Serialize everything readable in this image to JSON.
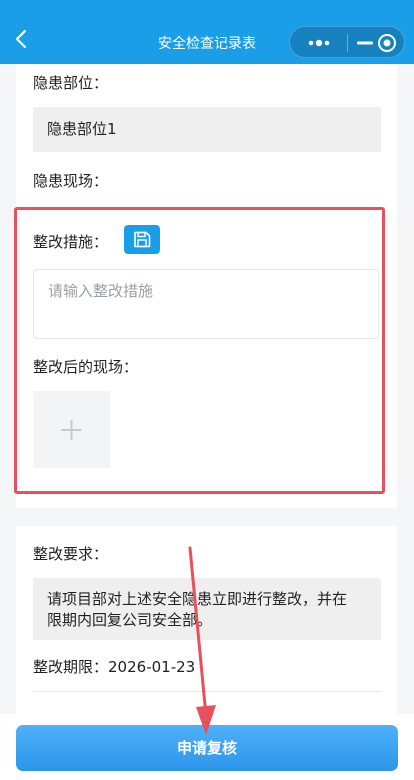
{
  "nav": {
    "title": "安全检查记录表",
    "back_icon": "chevron-left-icon"
  },
  "capsule": {
    "more_icon": "more-dots-icon",
    "minimize_icon": "minimize-icon",
    "close_icon": "target-circle-icon"
  },
  "hazard": {
    "location_label": "隐患部位：",
    "location_value": "隐患部位1",
    "scene_label": "隐患现场："
  },
  "rectify": {
    "measures_label": "整改措施：",
    "save_icon": "save-disk-icon",
    "measures_placeholder": "请输入整改措施",
    "after_scene_label": "整改后的现场：",
    "upload_icon": "plus-icon"
  },
  "requirements": {
    "label": "整改要求：",
    "text_line1": "请项目部对上述安全隐患立即进行整改，并在",
    "text_line2": "限期内回复公司安全部。",
    "deadline_label": "整改期限：",
    "deadline_value": "2026-01-23"
  },
  "actions": {
    "submit_label": "申请复核"
  },
  "colors": {
    "primary": "#1a9ee8",
    "highlight": "#e8505b"
  }
}
